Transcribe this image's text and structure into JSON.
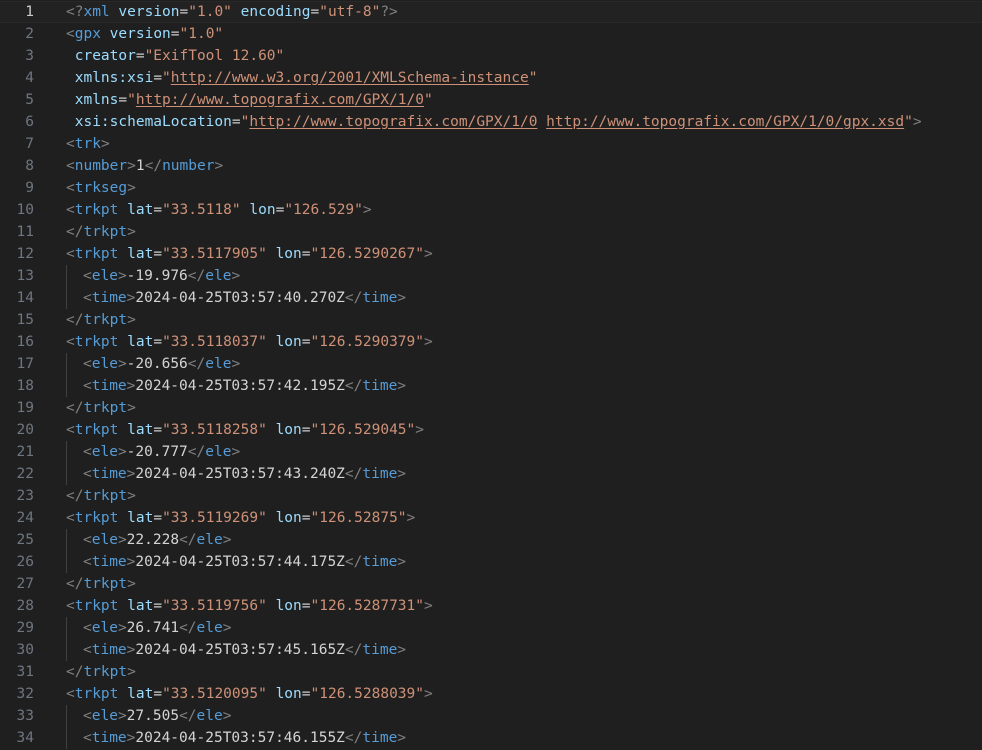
{
  "editor": {
    "current_line": 1,
    "lines": [
      {
        "n": "1",
        "indent": 0,
        "tokens": [
          [
            "b",
            "<?"
          ],
          [
            "t",
            "xml"
          ],
          [
            "x",
            " "
          ],
          [
            "a",
            "version"
          ],
          [
            "e",
            "="
          ],
          [
            "s",
            "\"1.0\""
          ],
          [
            "x",
            " "
          ],
          [
            "a",
            "encoding"
          ],
          [
            "e",
            "="
          ],
          [
            "s",
            "\"utf-8\""
          ],
          [
            "b",
            "?>"
          ]
        ]
      },
      {
        "n": "2",
        "indent": 0,
        "tokens": [
          [
            "b",
            "<"
          ],
          [
            "t",
            "gpx"
          ],
          [
            "x",
            " "
          ],
          [
            "a",
            "version"
          ],
          [
            "e",
            "="
          ],
          [
            "s",
            "\"1.0\""
          ]
        ]
      },
      {
        "n": "3",
        "indent": 0,
        "tokens": [
          [
            "x",
            " "
          ],
          [
            "a",
            "creator"
          ],
          [
            "e",
            "="
          ],
          [
            "s",
            "\"ExifTool 12.60\""
          ]
        ]
      },
      {
        "n": "4",
        "indent": 0,
        "tokens": [
          [
            "x",
            " "
          ],
          [
            "a",
            "xmlns:xsi"
          ],
          [
            "e",
            "="
          ],
          [
            "s",
            "\""
          ],
          [
            "l",
            "http://www.w3.org/2001/XMLSchema-instance"
          ],
          [
            "s",
            "\""
          ]
        ]
      },
      {
        "n": "5",
        "indent": 0,
        "tokens": [
          [
            "x",
            " "
          ],
          [
            "a",
            "xmlns"
          ],
          [
            "e",
            "="
          ],
          [
            "s",
            "\""
          ],
          [
            "l",
            "http://www.topografix.com/GPX/1/0"
          ],
          [
            "s",
            "\""
          ]
        ]
      },
      {
        "n": "6",
        "indent": 0,
        "tokens": [
          [
            "x",
            " "
          ],
          [
            "a",
            "xsi:schemaLocation"
          ],
          [
            "e",
            "="
          ],
          [
            "s",
            "\""
          ],
          [
            "l",
            "http://www.topografix.com/GPX/1/0"
          ],
          [
            "s",
            " "
          ],
          [
            "l",
            "http://www.topografix.com/GPX/1/0/gpx.xsd"
          ],
          [
            "s",
            "\""
          ],
          [
            "b",
            ">"
          ]
        ]
      },
      {
        "n": "7",
        "indent": 0,
        "tokens": [
          [
            "b",
            "<"
          ],
          [
            "t",
            "trk"
          ],
          [
            "b",
            ">"
          ]
        ]
      },
      {
        "n": "8",
        "indent": 0,
        "tokens": [
          [
            "b",
            "<"
          ],
          [
            "t",
            "number"
          ],
          [
            "b",
            ">"
          ],
          [
            "x",
            "1"
          ],
          [
            "b",
            "</"
          ],
          [
            "t",
            "number"
          ],
          [
            "b",
            ">"
          ]
        ]
      },
      {
        "n": "9",
        "indent": 0,
        "tokens": [
          [
            "b",
            "<"
          ],
          [
            "t",
            "trkseg"
          ],
          [
            "b",
            ">"
          ]
        ]
      },
      {
        "n": "10",
        "indent": 0,
        "tokens": [
          [
            "b",
            "<"
          ],
          [
            "t",
            "trkpt"
          ],
          [
            "x",
            " "
          ],
          [
            "a",
            "lat"
          ],
          [
            "e",
            "="
          ],
          [
            "s",
            "\"33.5118\""
          ],
          [
            "x",
            " "
          ],
          [
            "a",
            "lon"
          ],
          [
            "e",
            "="
          ],
          [
            "s",
            "\"126.529\""
          ],
          [
            "b",
            ">"
          ]
        ]
      },
      {
        "n": "11",
        "indent": 0,
        "tokens": [
          [
            "b",
            "</"
          ],
          [
            "t",
            "trkpt"
          ],
          [
            "b",
            ">"
          ]
        ]
      },
      {
        "n": "12",
        "indent": 0,
        "tokens": [
          [
            "b",
            "<"
          ],
          [
            "t",
            "trkpt"
          ],
          [
            "x",
            " "
          ],
          [
            "a",
            "lat"
          ],
          [
            "e",
            "="
          ],
          [
            "s",
            "\"33.5117905\""
          ],
          [
            "x",
            " "
          ],
          [
            "a",
            "lon"
          ],
          [
            "e",
            "="
          ],
          [
            "s",
            "\"126.5290267\""
          ],
          [
            "b",
            ">"
          ]
        ]
      },
      {
        "n": "13",
        "indent": 1,
        "tokens": [
          [
            "b",
            "<"
          ],
          [
            "t",
            "ele"
          ],
          [
            "b",
            ">"
          ],
          [
            "x",
            "-19.976"
          ],
          [
            "b",
            "</"
          ],
          [
            "t",
            "ele"
          ],
          [
            "b",
            ">"
          ]
        ]
      },
      {
        "n": "14",
        "indent": 1,
        "tokens": [
          [
            "b",
            "<"
          ],
          [
            "t",
            "time"
          ],
          [
            "b",
            ">"
          ],
          [
            "x",
            "2024-04-25T03:57:40.270Z"
          ],
          [
            "b",
            "</"
          ],
          [
            "t",
            "time"
          ],
          [
            "b",
            ">"
          ]
        ]
      },
      {
        "n": "15",
        "indent": 0,
        "tokens": [
          [
            "b",
            "</"
          ],
          [
            "t",
            "trkpt"
          ],
          [
            "b",
            ">"
          ]
        ]
      },
      {
        "n": "16",
        "indent": 0,
        "tokens": [
          [
            "b",
            "<"
          ],
          [
            "t",
            "trkpt"
          ],
          [
            "x",
            " "
          ],
          [
            "a",
            "lat"
          ],
          [
            "e",
            "="
          ],
          [
            "s",
            "\"33.5118037\""
          ],
          [
            "x",
            " "
          ],
          [
            "a",
            "lon"
          ],
          [
            "e",
            "="
          ],
          [
            "s",
            "\"126.5290379\""
          ],
          [
            "b",
            ">"
          ]
        ]
      },
      {
        "n": "17",
        "indent": 1,
        "tokens": [
          [
            "b",
            "<"
          ],
          [
            "t",
            "ele"
          ],
          [
            "b",
            ">"
          ],
          [
            "x",
            "-20.656"
          ],
          [
            "b",
            "</"
          ],
          [
            "t",
            "ele"
          ],
          [
            "b",
            ">"
          ]
        ]
      },
      {
        "n": "18",
        "indent": 1,
        "tokens": [
          [
            "b",
            "<"
          ],
          [
            "t",
            "time"
          ],
          [
            "b",
            ">"
          ],
          [
            "x",
            "2024-04-25T03:57:42.195Z"
          ],
          [
            "b",
            "</"
          ],
          [
            "t",
            "time"
          ],
          [
            "b",
            ">"
          ]
        ]
      },
      {
        "n": "19",
        "indent": 0,
        "tokens": [
          [
            "b",
            "</"
          ],
          [
            "t",
            "trkpt"
          ],
          [
            "b",
            ">"
          ]
        ]
      },
      {
        "n": "20",
        "indent": 0,
        "tokens": [
          [
            "b",
            "<"
          ],
          [
            "t",
            "trkpt"
          ],
          [
            "x",
            " "
          ],
          [
            "a",
            "lat"
          ],
          [
            "e",
            "="
          ],
          [
            "s",
            "\"33.5118258\""
          ],
          [
            "x",
            " "
          ],
          [
            "a",
            "lon"
          ],
          [
            "e",
            "="
          ],
          [
            "s",
            "\"126.529045\""
          ],
          [
            "b",
            ">"
          ]
        ]
      },
      {
        "n": "21",
        "indent": 1,
        "tokens": [
          [
            "b",
            "<"
          ],
          [
            "t",
            "ele"
          ],
          [
            "b",
            ">"
          ],
          [
            "x",
            "-20.777"
          ],
          [
            "b",
            "</"
          ],
          [
            "t",
            "ele"
          ],
          [
            "b",
            ">"
          ]
        ]
      },
      {
        "n": "22",
        "indent": 1,
        "tokens": [
          [
            "b",
            "<"
          ],
          [
            "t",
            "time"
          ],
          [
            "b",
            ">"
          ],
          [
            "x",
            "2024-04-25T03:57:43.240Z"
          ],
          [
            "b",
            "</"
          ],
          [
            "t",
            "time"
          ],
          [
            "b",
            ">"
          ]
        ]
      },
      {
        "n": "23",
        "indent": 0,
        "tokens": [
          [
            "b",
            "</"
          ],
          [
            "t",
            "trkpt"
          ],
          [
            "b",
            ">"
          ]
        ]
      },
      {
        "n": "24",
        "indent": 0,
        "tokens": [
          [
            "b",
            "<"
          ],
          [
            "t",
            "trkpt"
          ],
          [
            "x",
            " "
          ],
          [
            "a",
            "lat"
          ],
          [
            "e",
            "="
          ],
          [
            "s",
            "\"33.5119269\""
          ],
          [
            "x",
            " "
          ],
          [
            "a",
            "lon"
          ],
          [
            "e",
            "="
          ],
          [
            "s",
            "\"126.52875\""
          ],
          [
            "b",
            ">"
          ]
        ]
      },
      {
        "n": "25",
        "indent": 1,
        "tokens": [
          [
            "b",
            "<"
          ],
          [
            "t",
            "ele"
          ],
          [
            "b",
            ">"
          ],
          [
            "x",
            "22.228"
          ],
          [
            "b",
            "</"
          ],
          [
            "t",
            "ele"
          ],
          [
            "b",
            ">"
          ]
        ]
      },
      {
        "n": "26",
        "indent": 1,
        "tokens": [
          [
            "b",
            "<"
          ],
          [
            "t",
            "time"
          ],
          [
            "b",
            ">"
          ],
          [
            "x",
            "2024-04-25T03:57:44.175Z"
          ],
          [
            "b",
            "</"
          ],
          [
            "t",
            "time"
          ],
          [
            "b",
            ">"
          ]
        ]
      },
      {
        "n": "27",
        "indent": 0,
        "tokens": [
          [
            "b",
            "</"
          ],
          [
            "t",
            "trkpt"
          ],
          [
            "b",
            ">"
          ]
        ]
      },
      {
        "n": "28",
        "indent": 0,
        "tokens": [
          [
            "b",
            "<"
          ],
          [
            "t",
            "trkpt"
          ],
          [
            "x",
            " "
          ],
          [
            "a",
            "lat"
          ],
          [
            "e",
            "="
          ],
          [
            "s",
            "\"33.5119756\""
          ],
          [
            "x",
            " "
          ],
          [
            "a",
            "lon"
          ],
          [
            "e",
            "="
          ],
          [
            "s",
            "\"126.5287731\""
          ],
          [
            "b",
            ">"
          ]
        ]
      },
      {
        "n": "29",
        "indent": 1,
        "tokens": [
          [
            "b",
            "<"
          ],
          [
            "t",
            "ele"
          ],
          [
            "b",
            ">"
          ],
          [
            "x",
            "26.741"
          ],
          [
            "b",
            "</"
          ],
          [
            "t",
            "ele"
          ],
          [
            "b",
            ">"
          ]
        ]
      },
      {
        "n": "30",
        "indent": 1,
        "tokens": [
          [
            "b",
            "<"
          ],
          [
            "t",
            "time"
          ],
          [
            "b",
            ">"
          ],
          [
            "x",
            "2024-04-25T03:57:45.165Z"
          ],
          [
            "b",
            "</"
          ],
          [
            "t",
            "time"
          ],
          [
            "b",
            ">"
          ]
        ]
      },
      {
        "n": "31",
        "indent": 0,
        "tokens": [
          [
            "b",
            "</"
          ],
          [
            "t",
            "trkpt"
          ],
          [
            "b",
            ">"
          ]
        ]
      },
      {
        "n": "32",
        "indent": 0,
        "tokens": [
          [
            "b",
            "<"
          ],
          [
            "t",
            "trkpt"
          ],
          [
            "x",
            " "
          ],
          [
            "a",
            "lat"
          ],
          [
            "e",
            "="
          ],
          [
            "s",
            "\"33.5120095\""
          ],
          [
            "x",
            " "
          ],
          [
            "a",
            "lon"
          ],
          [
            "e",
            "="
          ],
          [
            "s",
            "\"126.5288039\""
          ],
          [
            "b",
            ">"
          ]
        ]
      },
      {
        "n": "33",
        "indent": 1,
        "tokens": [
          [
            "b",
            "<"
          ],
          [
            "t",
            "ele"
          ],
          [
            "b",
            ">"
          ],
          [
            "x",
            "27.505"
          ],
          [
            "b",
            "</"
          ],
          [
            "t",
            "ele"
          ],
          [
            "b",
            ">"
          ]
        ]
      },
      {
        "n": "34",
        "indent": 1,
        "tokens": [
          [
            "b",
            "<"
          ],
          [
            "t",
            "time"
          ],
          [
            "b",
            ">"
          ],
          [
            "x",
            "2024-04-25T03:57:46.155Z"
          ],
          [
            "b",
            "</"
          ],
          [
            "t",
            "time"
          ],
          [
            "b",
            ">"
          ]
        ]
      }
    ]
  },
  "colors": {
    "background": "#1f1f1f",
    "tag": "#569cd6",
    "attribute": "#9cdcfe",
    "string": "#ce9178",
    "bracket": "#808080",
    "text": "#d4d4d4",
    "line_number": "#6e7681"
  }
}
